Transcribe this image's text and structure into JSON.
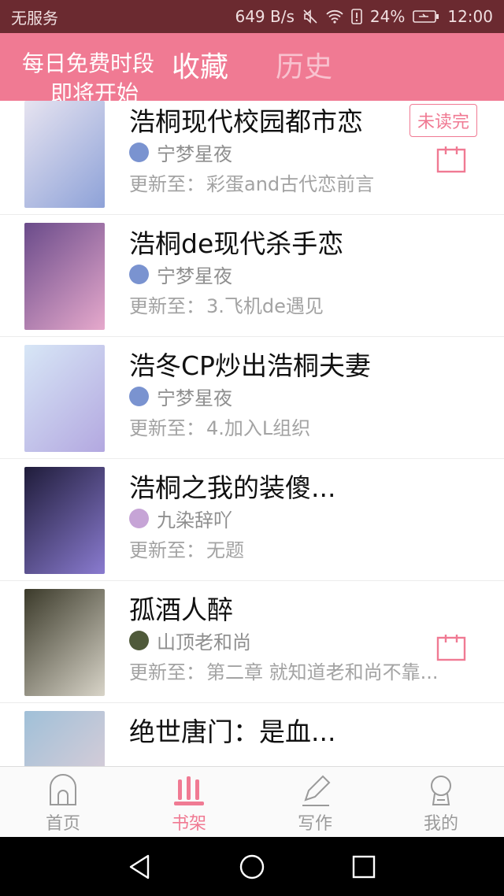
{
  "status_bar": {
    "carrier": "无服务",
    "speed": "649 B/s",
    "battery": "24%",
    "time": "12:00"
  },
  "header": {
    "promo_line1": "每日免费时段",
    "promo_line2": "即将开始",
    "tab_favorites": "收藏",
    "tab_history": "历史"
  },
  "list": {
    "update_prefix": "更新至：",
    "items": [
      {
        "title": "浩桐现代校园都市恋",
        "author": "宁梦星夜",
        "update": "彩蛋and古代恋前言",
        "badge": "未读完",
        "has_calendar": true,
        "cover_colors": [
          "#e6e3f0",
          "#8ea2d8"
        ],
        "avatar_color": "#7a93d0"
      },
      {
        "title": "浩桐de现代杀手恋",
        "author": "宁梦星夜",
        "update": "3.飞机de遇见",
        "badge": "",
        "has_calendar": false,
        "cover_colors": [
          "#6a4b8a",
          "#e6a9cc"
        ],
        "avatar_color": "#7a93d0"
      },
      {
        "title": "浩冬CP炒出浩桐夫妻",
        "author": "宁梦星夜",
        "update": "4.加入L组织",
        "badge": "",
        "has_calendar": false,
        "cover_colors": [
          "#d7e6f6",
          "#b3a8e0"
        ],
        "avatar_color": "#7a93d0"
      },
      {
        "title": "浩桐之我的装傻...",
        "author": "九染辞吖",
        "update": "无题",
        "badge": "",
        "has_calendar": false,
        "cover_colors": [
          "#1f1c3a",
          "#8a7bd0"
        ],
        "avatar_color": "#c6a4d6"
      },
      {
        "title": "孤酒人醉",
        "author": "山顶老和尚",
        "update": "第二章  就知道老和尚不靠...",
        "badge": "",
        "has_calendar": true,
        "cover_colors": [
          "#3b3a2a",
          "#d8d4c8"
        ],
        "avatar_color": "#4f5a3a"
      },
      {
        "title": "绝世唐门：是血...",
        "author": "",
        "update": "",
        "badge": "",
        "has_calendar": false,
        "cover_colors": [
          "#a0c0d8",
          "#e6d0d8"
        ],
        "avatar_color": "#9ab2d0"
      }
    ]
  },
  "tab_bar": {
    "home": "首页",
    "bookshelf": "书架",
    "write": "写作",
    "mine": "我的"
  },
  "colors": {
    "accent": "#f07a93",
    "status_bar": "#6b2a30"
  }
}
